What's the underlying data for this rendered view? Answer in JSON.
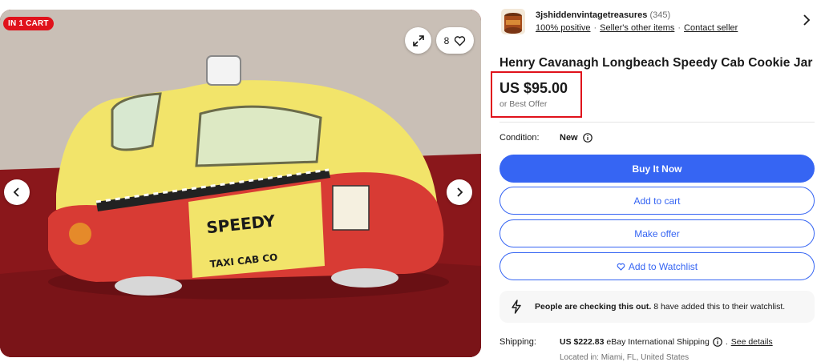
{
  "gallery": {
    "badge": "IN 1 CART",
    "watch_count": "8",
    "icons": {
      "expand": "expand-icon",
      "heart": "heart-icon",
      "prev": "chevron-left-icon",
      "next": "chevron-right-icon"
    }
  },
  "seller": {
    "name": "3jshiddenvintagetreasures",
    "count": "(345)",
    "positive": "100% positive",
    "other_items": "Seller's other items",
    "contact": "Contact seller",
    "chevron_icon": "chevron-right-icon"
  },
  "listing": {
    "title": "Henry Cavanagh Longbeach Speedy Cab Cookie Jar",
    "price": "US $95.00",
    "best_offer": "or Best Offer",
    "condition_label": "Condition:",
    "condition_value": "New"
  },
  "actions": {
    "buy_now": "Buy It Now",
    "add_to_cart": "Add to cart",
    "make_offer": "Make offer",
    "watchlist": "Add to Watchlist"
  },
  "alert": {
    "bold": "People are checking this out.",
    "text": " 8 have added this to their watchlist."
  },
  "shipping": {
    "label": "Shipping:",
    "price": "US $222.83",
    "method": " eBay International Shipping",
    "details_link": "See details",
    "location": "Located in: Miami, FL, United States"
  },
  "colors": {
    "accent": "#3665f3",
    "badge": "#e0121b",
    "highlight_box": "#e0121b"
  }
}
